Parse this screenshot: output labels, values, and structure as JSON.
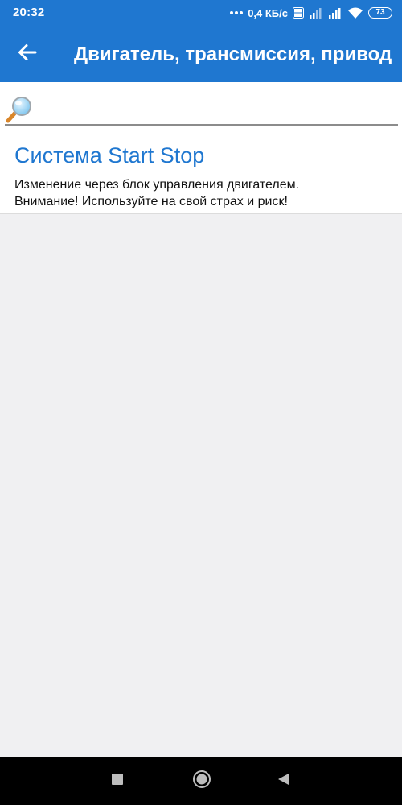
{
  "status_bar": {
    "time": "20:32",
    "network_speed": "0,4 КБ/с",
    "battery_level": "73",
    "icons": [
      "more-dots-icon",
      "volte-icon",
      "signal-icon",
      "signal-icon",
      "wifi-icon",
      "battery-icon"
    ]
  },
  "app_bar": {
    "title": "Двигатель, трансмиссия, привод",
    "back_icon": "arrow-left-icon"
  },
  "search": {
    "icon": "magnifier-icon",
    "value": "",
    "placeholder": ""
  },
  "list": {
    "items": [
      {
        "title": "Система Start Stop",
        "description_line1": "Изменение через блок управления двигателем.",
        "description_line2": "Внимание! Используйте на свой страх и риск!"
      }
    ]
  },
  "nav_bar": {
    "icons": [
      "recents-square-icon",
      "home-circle-icon",
      "back-triangle-icon"
    ]
  },
  "colors": {
    "primary": "#1f77d0",
    "background": "#f0f0f2",
    "surface": "#ffffff",
    "title_text": "#1f77d0",
    "body_text": "#111111",
    "nav_bar": "#000000"
  }
}
